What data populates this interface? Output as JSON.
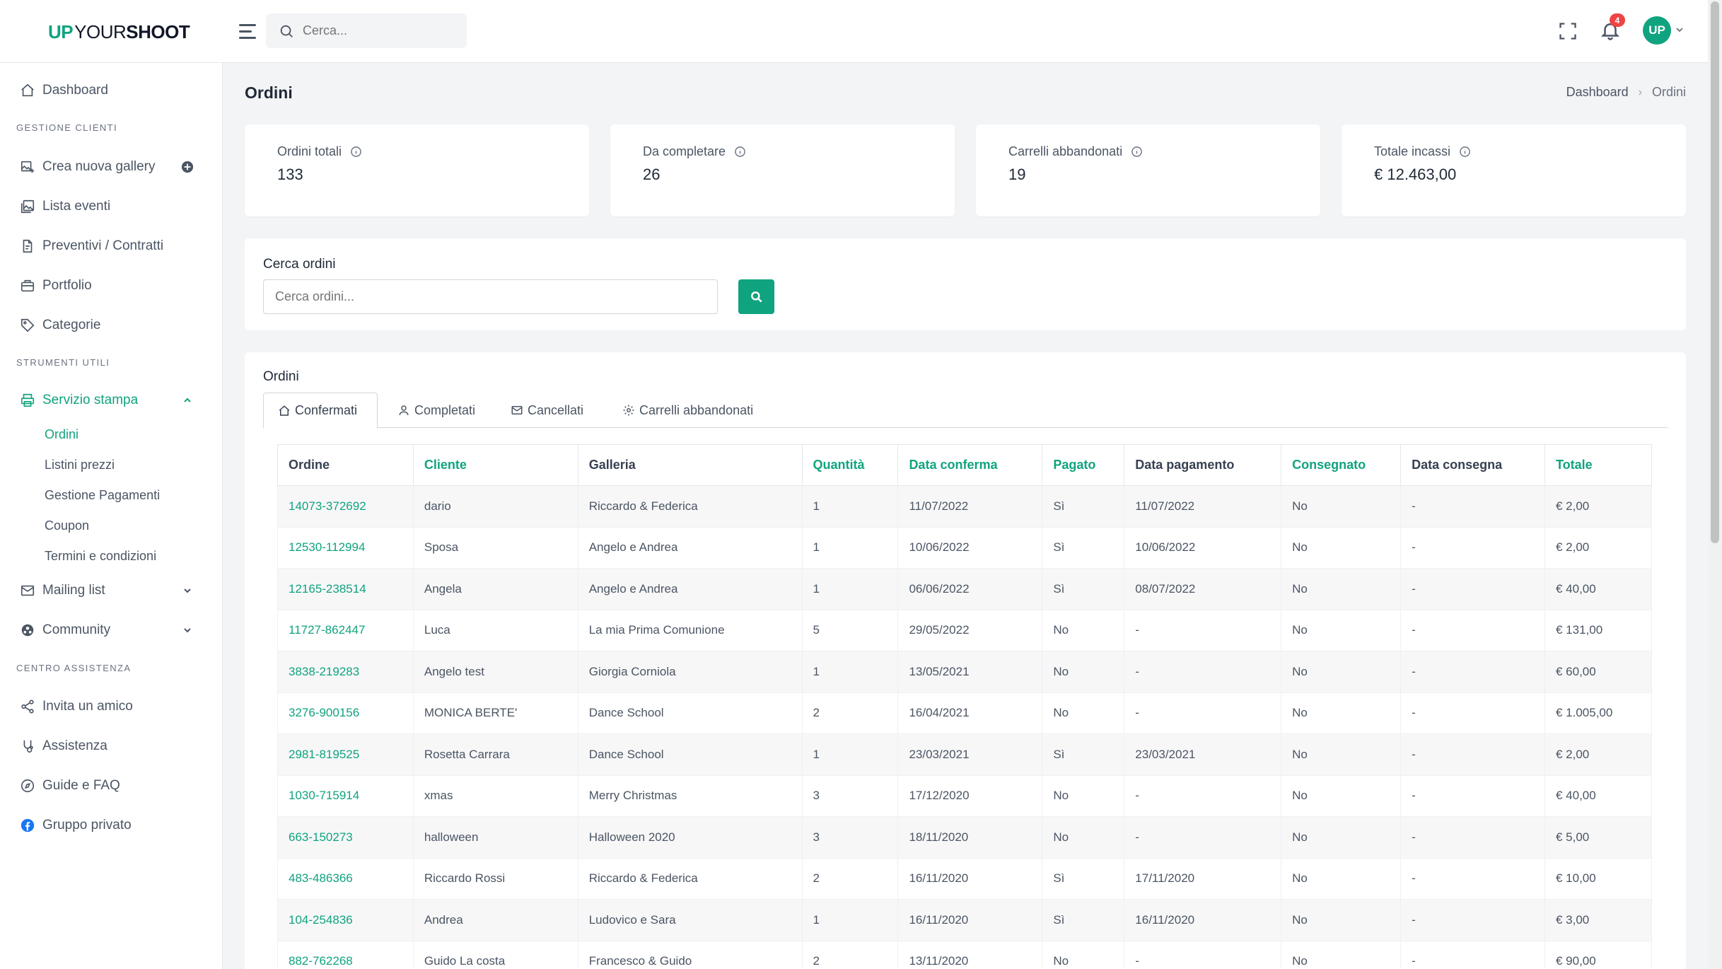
{
  "header": {
    "logo_up": "UP",
    "logo_your": "YOUR",
    "logo_shoot": "SHOOT",
    "search_placeholder": "Cerca...",
    "notifications_count": "4",
    "avatar_initials": "UP"
  },
  "sidebar": {
    "dashboard": "Dashboard",
    "section_clients": "GESTIONE CLIENTI",
    "create_gallery": "Crea nuova gallery",
    "events_list": "Lista eventi",
    "quotes": "Preventivi / Contratti",
    "portfolio": "Portfolio",
    "categories": "Categorie",
    "section_tools": "STRUMENTI UTILI",
    "print_service": "Servizio stampa",
    "print_sub": [
      "Ordini",
      "Listini prezzi",
      "Gestione Pagamenti",
      "Coupon",
      "Termini e condizioni"
    ],
    "mailing": "Mailing list",
    "community": "Community",
    "section_help": "CENTRO ASSISTENZA",
    "invite": "Invita un amico",
    "support": "Assistenza",
    "guides": "Guide e FAQ",
    "private_group": "Gruppo privato"
  },
  "page": {
    "title": "Ordini",
    "breadcrumb": [
      "Dashboard",
      "Ordini"
    ]
  },
  "stats": [
    {
      "label": "Ordini totali",
      "value": "133"
    },
    {
      "label": "Da completare",
      "value": "26"
    },
    {
      "label": "Carrelli abbandonati",
      "value": "19"
    },
    {
      "label": "Totale incassi",
      "value": "€ 12.463,00"
    }
  ],
  "search": {
    "title": "Cerca ordini",
    "placeholder": "Cerca ordini..."
  },
  "orders": {
    "title": "Ordini",
    "tabs": [
      "Confermati",
      "Completati",
      "Cancellati",
      "Carrelli abbandonati"
    ],
    "columns": [
      "Ordine",
      "Cliente",
      "Galleria",
      "Quantità",
      "Data conferma",
      "Pagato",
      "Data pagamento",
      "Consegnato",
      "Data consegna",
      "Totale"
    ],
    "rows": [
      [
        "14073-372692",
        "dario",
        "Riccardo & Federica",
        "1",
        "11/07/2022",
        "Sì",
        "11/07/2022",
        "No",
        "-",
        "€ 2,00"
      ],
      [
        "12530-112994",
        "Sposa",
        "Angelo e Andrea",
        "1",
        "10/06/2022",
        "Sì",
        "10/06/2022",
        "No",
        "-",
        "€ 2,00"
      ],
      [
        "12165-238514",
        "Angela",
        "Angelo e Andrea",
        "1",
        "06/06/2022",
        "Sì",
        "08/07/2022",
        "No",
        "-",
        "€ 40,00"
      ],
      [
        "11727-862447",
        "Luca",
        "La mia Prima Comunione",
        "5",
        "29/05/2022",
        "No",
        "-",
        "No",
        "-",
        "€ 131,00"
      ],
      [
        "3838-219283",
        "Angelo test",
        "Giorgia Corniola",
        "1",
        "13/05/2021",
        "No",
        "-",
        "No",
        "-",
        "€ 60,00"
      ],
      [
        "3276-900156",
        "MONICA BERTE'",
        "Dance School",
        "2",
        "16/04/2021",
        "No",
        "-",
        "No",
        "-",
        "€ 1.005,00"
      ],
      [
        "2981-819525",
        "Rosetta Carrara",
        "Dance School",
        "1",
        "23/03/2021",
        "Sì",
        "23/03/2021",
        "No",
        "-",
        "€ 2,00"
      ],
      [
        "1030-715914",
        "xmas",
        "Merry Christmas",
        "3",
        "17/12/2020",
        "No",
        "-",
        "No",
        "-",
        "€ 40,00"
      ],
      [
        "663-150273",
        "halloween",
        "Halloween 2020",
        "3",
        "18/11/2020",
        "No",
        "-",
        "No",
        "-",
        "€ 5,00"
      ],
      [
        "483-486366",
        "Riccardo Rossi",
        "Riccardo & Federica",
        "2",
        "16/11/2020",
        "Sì",
        "17/11/2020",
        "No",
        "-",
        "€ 10,00"
      ],
      [
        "104-254836",
        "Andrea",
        "Ludovico e Sara",
        "1",
        "16/11/2020",
        "Sì",
        "16/11/2020",
        "No",
        "-",
        "€ 3,00"
      ],
      [
        "882-762268",
        "Guido La costa",
        "Francesco & Guido",
        "2",
        "13/11/2020",
        "No",
        "-",
        "No",
        "-",
        "€ 90,00"
      ]
    ]
  },
  "colors": {
    "accent": "#10a37f",
    "badge": "#ef4444"
  }
}
